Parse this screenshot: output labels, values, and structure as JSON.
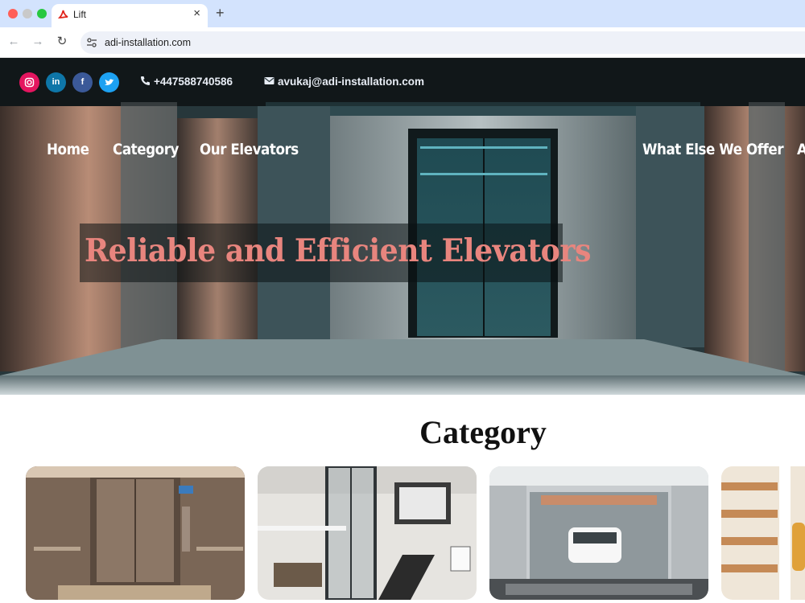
{
  "browser": {
    "tab_title": "Lift",
    "tab_icon": "pdf-icon",
    "url": "adi-installation.com"
  },
  "hero": {
    "social_icons": [
      "instagram-icon",
      "linkedin-icon",
      "facebook-icon",
      "twitter-icon"
    ],
    "social_labels": {
      "linkedin": "in",
      "facebook": "f"
    },
    "phone": "+447588740586",
    "email": "avukaj@adi-installation.com",
    "nav": {
      "home": "Home",
      "category": "Category",
      "elevators": "Our Elevators",
      "offer": "What Else We Offer",
      "more": "A"
    },
    "title": "Reliable and Efficient Elevators",
    "title_color": "#e8857e"
  },
  "category": {
    "heading": "Category"
  },
  "colors": {
    "tabbar": "#d3e3fd",
    "instagram": "#e4155f",
    "linkedin": "#0e76a8",
    "facebook": "#3b5998",
    "twitter": "#1da1f2"
  }
}
